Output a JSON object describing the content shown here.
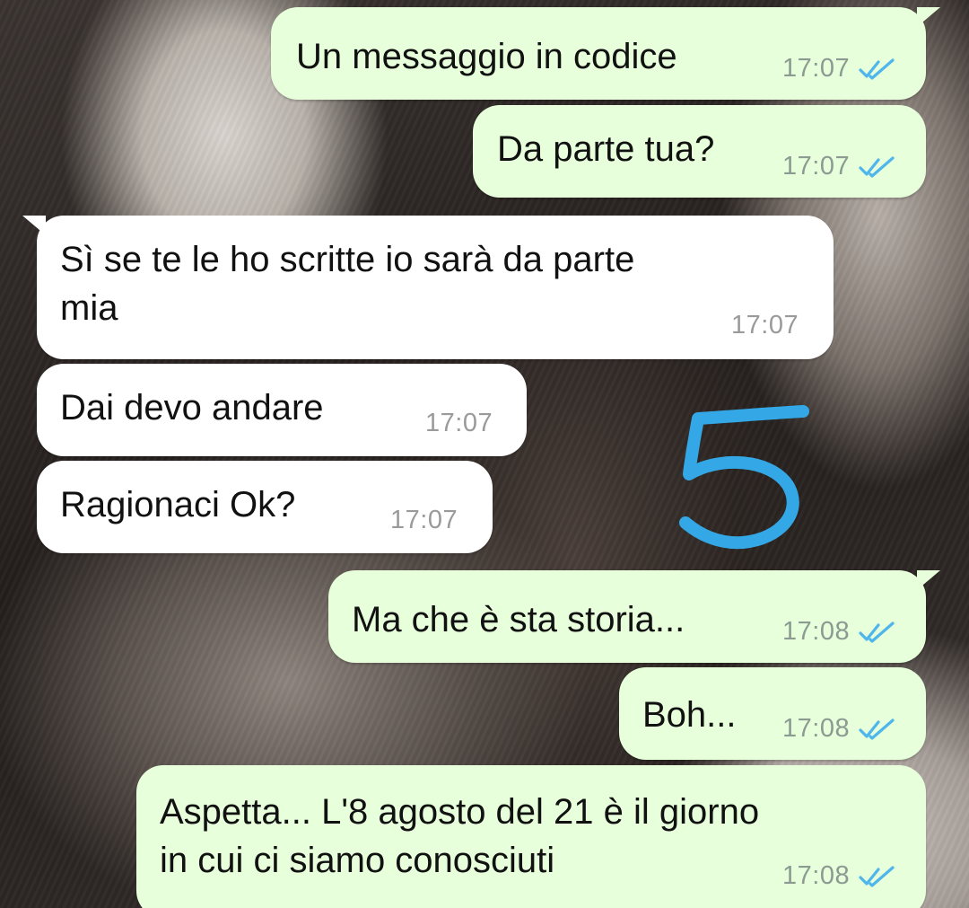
{
  "colors": {
    "outgoing_bubble": "#e7ffdb",
    "incoming_bubble": "#ffffff",
    "read_ticks": "#4fb6ec",
    "drawing_stroke": "#34a8e6"
  },
  "messages": [
    {
      "direction": "out",
      "text": "Un messaggio in codice",
      "time": "17:07",
      "status": "read"
    },
    {
      "direction": "out",
      "text": "Da parte tua?",
      "time": "17:07",
      "status": "read"
    },
    {
      "direction": "in",
      "text": "Sì se te le ho scritte io sarà da parte\nmia",
      "time": "17:07"
    },
    {
      "direction": "in",
      "text": "Dai devo andare",
      "time": "17:07"
    },
    {
      "direction": "in",
      "text": "Ragionaci Ok?",
      "time": "17:07"
    },
    {
      "direction": "out",
      "text": "Ma che è sta storia...",
      "time": "17:08",
      "status": "read"
    },
    {
      "direction": "out",
      "text": "Boh...",
      "time": "17:08",
      "status": "read"
    },
    {
      "direction": "out",
      "text": "Aspetta... L'8 agosto del 21 è il giorno\nin cui ci siamo conosciuti",
      "time": "17:08",
      "status": "read"
    }
  ],
  "drawing": {
    "text": "5",
    "icon": "handwritten-five"
  },
  "icons": {
    "status_read": "double-check-icon"
  }
}
